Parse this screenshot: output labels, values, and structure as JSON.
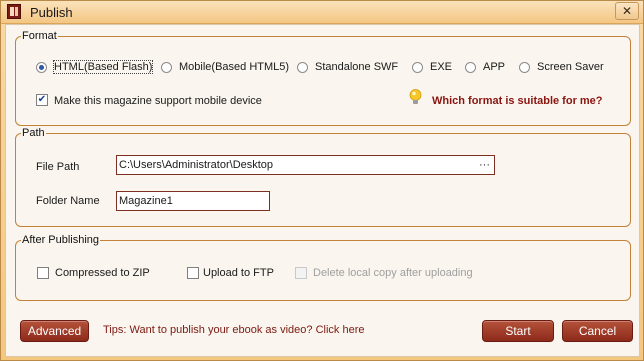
{
  "window": {
    "title": "Publish",
    "close_glyph": "✕"
  },
  "format": {
    "legend": "Format",
    "options": [
      "HTML(Based Flash)",
      "Mobile(Based HTML5)",
      "Standalone SWF",
      "EXE",
      "APP",
      "Screen Saver"
    ],
    "selected": "HTML(Based Flash)",
    "mobile_support": {
      "label": "Make this magazine support mobile device",
      "checked": true
    },
    "help_link": "Which format is suitable for me?"
  },
  "path": {
    "legend": "Path",
    "file_path_label": "File Path",
    "file_path_value": "C:\\Users\\Administrator\\Desktop",
    "browse_glyph": "···",
    "folder_name_label": "Folder Name",
    "folder_name_value": "Magazine1"
  },
  "after": {
    "legend": "After Publishing",
    "compressed_zip": {
      "label": "Compressed to ZIP",
      "checked": false
    },
    "upload_ftp": {
      "label": "Upload to FTP",
      "checked": false
    },
    "delete_local": {
      "label": "Delete local copy after uploading",
      "checked": false,
      "enabled": false
    }
  },
  "footer": {
    "advanced": "Advanced",
    "tips": "Tips: Want to publish your ebook as video? Click here",
    "start": "Start",
    "cancel": "Cancel"
  },
  "colors": {
    "accent": "#8d2a1b",
    "border": "#c2823a",
    "frame": "#f4c77f"
  }
}
